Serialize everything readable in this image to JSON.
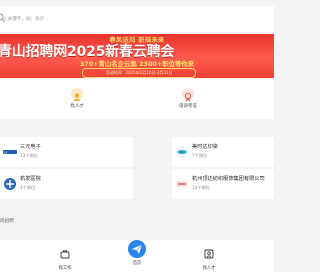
{
  "search": {
    "placeholder": "入关键字，如：会计..."
  },
  "banner": {
    "top": "春风送岗  职硕未来",
    "big": "青山招聘网2025新春云聘会",
    "mid": "370+青山名企云集  2300+职位等你来",
    "pill": "活动时间：2025年2月10日-3月31日"
  },
  "quick": [
    {
      "label": "找人才",
      "icon": "person-icon"
    },
    {
      "label": "培训考证",
      "icon": "certificate-icon"
    }
  ],
  "companies": [
    {
      "name": "三元电子",
      "count": "13个岗位",
      "logo": "sanyuan-logo"
    },
    {
      "name": "美时达印染",
      "count": "7个岗位",
      "logo": "meishida-logo"
    },
    {
      "name": "杭发医院",
      "count": "4个岗位",
      "logo": "hangfa-logo"
    },
    {
      "name": "杭州顶达纺织服饰集团有限公司",
      "count": "14个岗位",
      "logo": "dingda-logo"
    }
  ],
  "section": {
    "label": "岗招聘"
  },
  "nav": [
    {
      "label": "找工作",
      "icon": "briefcase-icon"
    },
    {
      "label": "首页",
      "icon": "paper-plane-icon"
    },
    {
      "label": "找人才",
      "icon": "person-card-icon"
    }
  ],
  "colors": {
    "brand": "#2a86ea",
    "banner": "#e7332b",
    "accent": "#f6a623"
  }
}
